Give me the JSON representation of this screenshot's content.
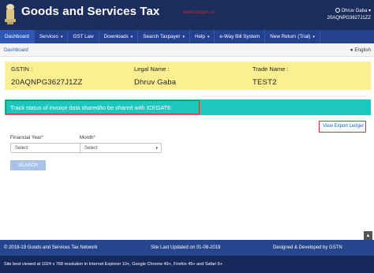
{
  "header": {
    "title": "Goods and Services Tax",
    "watermark": "www.taxguru.in",
    "user_name": "Dhruv Gaba",
    "user_gstin": "20AQNPG3627J1ZZ"
  },
  "nav": {
    "items": [
      {
        "label": "Dashboard",
        "dropdown": false
      },
      {
        "label": "Services",
        "dropdown": true
      },
      {
        "label": "GST Law",
        "dropdown": false
      },
      {
        "label": "Downloads",
        "dropdown": true
      },
      {
        "label": "Search Taxpayer",
        "dropdown": true
      },
      {
        "label": "Help",
        "dropdown": true
      },
      {
        "label": "e-Way Bill System",
        "dropdown": false
      },
      {
        "label": "New Return (Trial)",
        "dropdown": true
      }
    ],
    "caret": "▾"
  },
  "breadcrumb": "Dashboard",
  "language": "English",
  "taxpayer": {
    "gstin_label": "GSTIN :",
    "gstin": "20AQNPG3627J1ZZ",
    "legal_label": "Legal Name :",
    "legal_name": "Dhruv Gaba",
    "trade_label": "Trade Name :",
    "trade_name": "TEST2"
  },
  "page_title": "Track status of invoice data shared/to be shared with ICEGATE",
  "export_link": "View Export Ledger",
  "form": {
    "fy_label": "Financial Year",
    "fy_value": "Select",
    "month_label": "Month",
    "month_value": "Select",
    "required_mark": "*",
    "search_button": "SEARCH"
  },
  "footer": {
    "copyright": "© 2018-19 Goods and Services Tax Network",
    "last_updated": "Site Last Updated on 01-08-2019",
    "designed_by": "Designed & Developed by GSTN",
    "browser_note": "Site best viewed at 1024 x 768 resolution in Internet Explorer 10+, Google Chrome 49+, Firefox 45+ and Safari 6+",
    "top_arrow": "▲"
  },
  "colors": {
    "header_bg": "#1a2d5c",
    "nav_bg": "#24418e",
    "info_bg": "#fcef91",
    "title_bg": "#1ec6be",
    "highlight_border": "#d9302e"
  }
}
